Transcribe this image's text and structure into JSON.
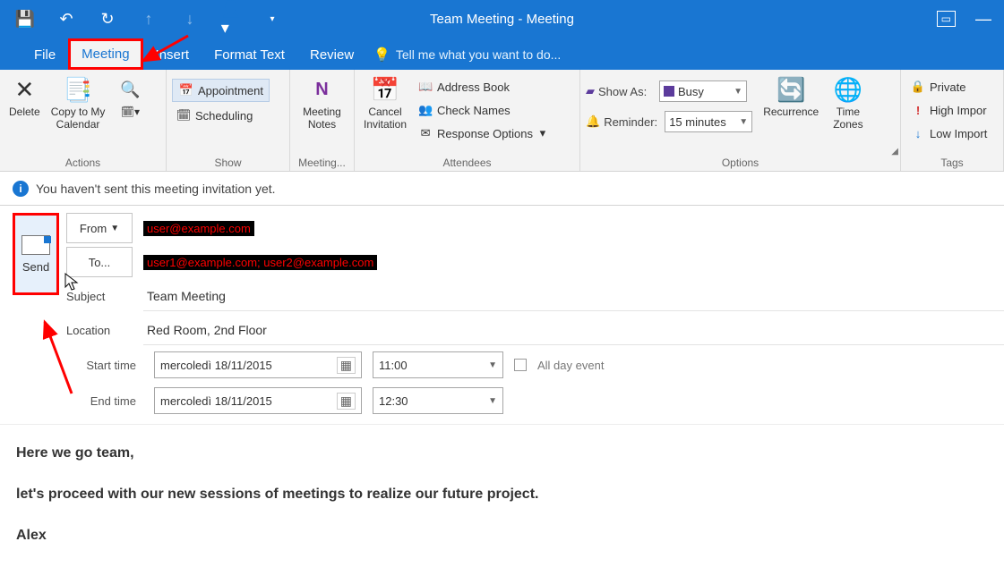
{
  "title": "Team Meeting - Meeting",
  "tabs": {
    "file": "File",
    "meeting": "Meeting",
    "insert": "Insert",
    "format": "Format Text",
    "review": "Review",
    "tellme": "Tell me what you want to do..."
  },
  "ribbon": {
    "actions": {
      "delete": "Delete",
      "copy": "Copy to My\nCalendar",
      "group_label": "Actions"
    },
    "show": {
      "appointment": "Appointment",
      "scheduling": "Scheduling",
      "group_label": "Show"
    },
    "meeting_notes": {
      "label": "Meeting\nNotes",
      "group_label": "Meeting..."
    },
    "cancel": {
      "label": "Cancel\nInvitation"
    },
    "attendees": {
      "address_book": "Address Book",
      "check_names": "Check Names",
      "response_options": "Response Options",
      "group_label": "Attendees"
    },
    "options": {
      "show_as_label": "Show As:",
      "show_as_value": "Busy",
      "reminder_label": "Reminder:",
      "reminder_value": "15 minutes",
      "recurrence": "Recurrence",
      "time_zones": "Time\nZones",
      "group_label": "Options"
    },
    "tags": {
      "private": "Private",
      "high": "High Impor",
      "low": "Low Import",
      "group_label": "Tags"
    }
  },
  "info_bar": "You haven't sent this meeting invitation yet.",
  "send_label": "Send",
  "from_label": "From",
  "from_value": "user@example.com",
  "to_label": "To...",
  "to_value": "user1@example.com; user2@example.com",
  "subject_label": "Subject",
  "subject_value": "Team Meeting",
  "location_label": "Location",
  "location_value": "Red Room, 2nd Floor",
  "start_label": "Start time",
  "start_date": "mercoledì 18/11/2015",
  "start_time": "11:00",
  "end_label": "End time",
  "end_date": "mercoledì 18/11/2015",
  "end_time": "12:30",
  "all_day": "All day event",
  "body": {
    "p1": "Here we go team,",
    "p2": "let's proceed with our new sessions of meetings to realize our future project.",
    "p3": "Alex"
  }
}
